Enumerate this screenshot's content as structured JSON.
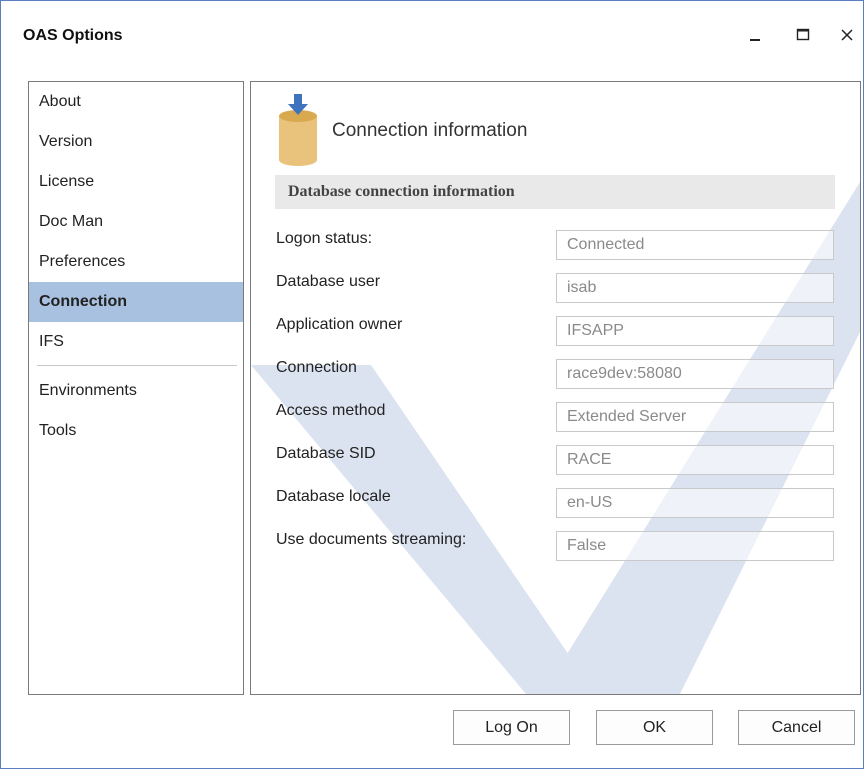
{
  "window": {
    "title": "OAS Options",
    "controls": [
      "minimize-icon",
      "maximize-icon",
      "close-icon"
    ]
  },
  "nav": {
    "items": [
      {
        "label": "About",
        "active": false
      },
      {
        "label": "Version",
        "active": false
      },
      {
        "label": "License",
        "active": false
      },
      {
        "label": "Doc Man",
        "active": false
      },
      {
        "label": "Preferences",
        "active": false
      },
      {
        "label": "Connection",
        "active": true
      },
      {
        "label": "IFS",
        "active": false
      },
      {
        "label": "Environments",
        "active": false
      },
      {
        "label": "Tools",
        "active": false
      }
    ]
  },
  "panel": {
    "icon": "database-download-icon",
    "heading": "Connection information",
    "section_title": "Database connection information",
    "fields": [
      {
        "label": "Logon status:",
        "value": "Connected"
      },
      {
        "label": "Database user",
        "value": "isab"
      },
      {
        "label": "Application owner",
        "value": "IFSAPP"
      },
      {
        "label": "Connection",
        "value": "race9dev:58080"
      },
      {
        "label": "Access method",
        "value": "Extended Server"
      },
      {
        "label": "Database SID",
        "value": "RACE"
      },
      {
        "label": "Database locale",
        "value": "en-US"
      },
      {
        "label": "Use documents streaming:",
        "value": "False"
      }
    ]
  },
  "buttons": {
    "log_on": "Log On",
    "ok": "OK",
    "cancel": "Cancel"
  },
  "colors": {
    "window_border": "#5a7ec1",
    "nav_active": "#a9c1e0",
    "watermark": "#dbe3f0",
    "db_icon_body": "#e9c27b",
    "db_icon_arrow": "#3f73bd"
  }
}
